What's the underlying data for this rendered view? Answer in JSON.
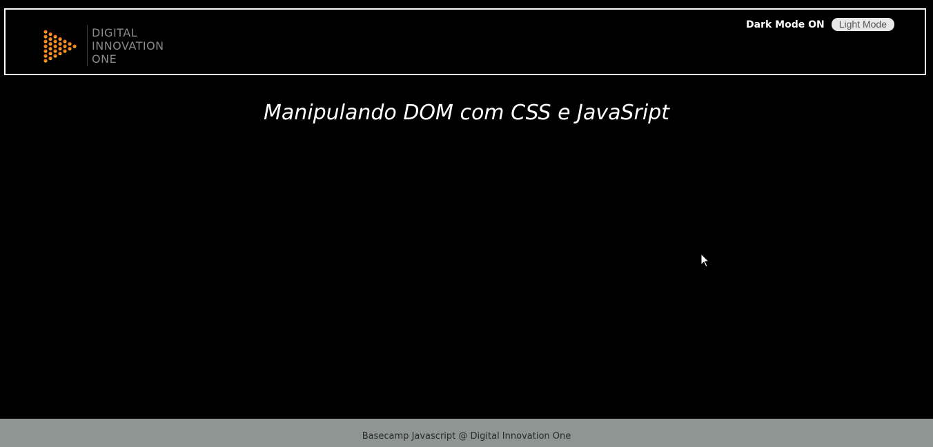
{
  "header": {
    "logo": {
      "line1": "DIGITAL",
      "line2": "INNOVATION",
      "line3": "ONE"
    },
    "mode_label": "Dark Mode ON",
    "mode_button_label": "Light Mode"
  },
  "main": {
    "title": "Manipulando DOM com CSS e JavaSript"
  },
  "footer": {
    "text": "Basecamp Javascript @ Digital Innovation One"
  },
  "colors": {
    "background": "#000000",
    "header_border": "#ffffff",
    "footer_background": "#8e9593",
    "logo_gradient_top": "#e0312b",
    "logo_gradient_bottom": "#f7c51b"
  }
}
